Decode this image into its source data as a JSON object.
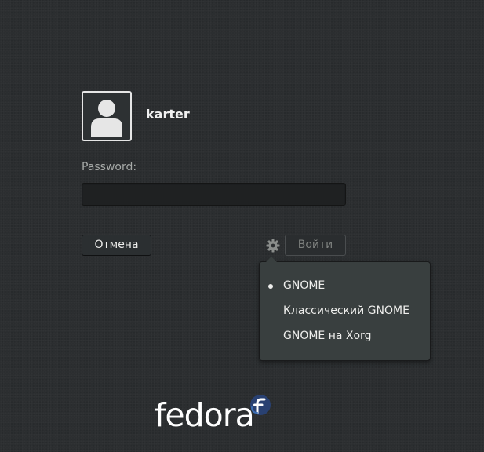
{
  "user": {
    "name": "karter"
  },
  "auth": {
    "password_label": "Password:",
    "password_value": ""
  },
  "buttons": {
    "cancel_label": "Отмена",
    "login_label": "Войти"
  },
  "session_menu": {
    "items": [
      {
        "label": "GNOME",
        "selected": true
      },
      {
        "label": "Классический GNOME",
        "selected": false
      },
      {
        "label": "GNOME на Xorg",
        "selected": false
      }
    ]
  },
  "branding": {
    "wordmark": "fedora",
    "logo_color": "#294172"
  },
  "icons": {
    "avatar": "user-avatar-icon",
    "session": "gear-icon",
    "selected": "radio-dot-icon",
    "brand": "fedora-logo-icon"
  }
}
